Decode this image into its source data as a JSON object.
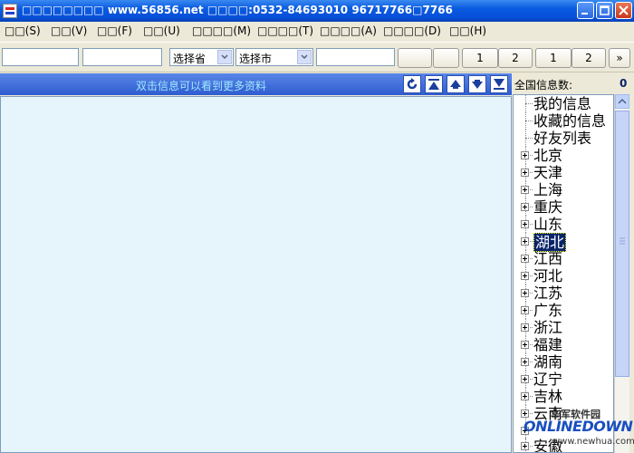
{
  "window": {
    "title": "□□□□□□□□ www.56856.net □□□□:0532-84693010  96717766□7766"
  },
  "menu": [
    "□□(S)",
    "□□(V)",
    "□□(F)",
    "□□(U)",
    "□□□□(M)",
    "□□□□(T)",
    "□□□□(A)",
    "□□□□(D)",
    "□□(H)"
  ],
  "toolbar": {
    "province_select": "选择省",
    "city_select": "选择市",
    "page_buttons": [
      "1",
      "2",
      "1",
      "2"
    ],
    "more_button": "»"
  },
  "left_panel": {
    "hint": "双击信息可以看到更多资料"
  },
  "right_panel": {
    "count_label": "全国信息数:",
    "count_value": "0",
    "tree_top": [
      "我的信息",
      "收藏的信息",
      "好友列表"
    ],
    "regions": [
      "北京",
      "天津",
      "上海",
      "重庆",
      "山东",
      "湖北",
      "江西",
      "河北",
      "江苏",
      "广东",
      "浙江",
      "福建",
      "湖南",
      "辽宁",
      "吉林",
      "云南",
      "",
      "安徽"
    ],
    "selected_region": "湖北"
  },
  "watermark": {
    "top": "华军软件园",
    "logo": "ONLINEDOWN",
    "url": "www.newhua.com"
  }
}
